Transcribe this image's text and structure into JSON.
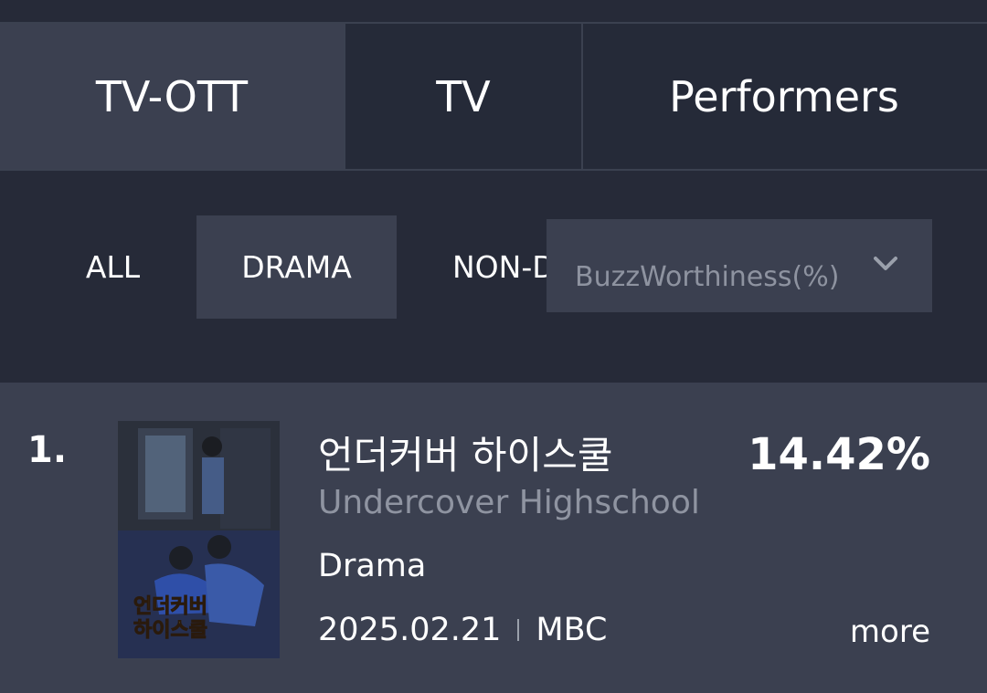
{
  "tabs": [
    {
      "label": "TV-OTT",
      "active": true
    },
    {
      "label": "TV",
      "active": false
    },
    {
      "label": "Performers",
      "active": false
    }
  ],
  "filters": {
    "chips": [
      {
        "label": "ALL",
        "active": false
      },
      {
        "label": "DRAMA",
        "active": true
      },
      {
        "label": "NON-D",
        "active": false
      }
    ],
    "metric_select": {
      "value": "BuzzWorthiness(%)",
      "icon": "chevron-down-icon"
    }
  },
  "ranking": [
    {
      "rank": "1.",
      "title_ko": "언더커버 하이스쿨",
      "title_en": "Undercover Highschool",
      "genre": "Drama",
      "date": "2025.02.21",
      "channel": "MBC",
      "score": "14.42%",
      "more_label": "more",
      "poster_text": "언더커버 하이스쿨"
    }
  ],
  "colors": {
    "background": "#262a38",
    "active_tab": "#3b4050",
    "subtitle": "#8f94a1"
  }
}
